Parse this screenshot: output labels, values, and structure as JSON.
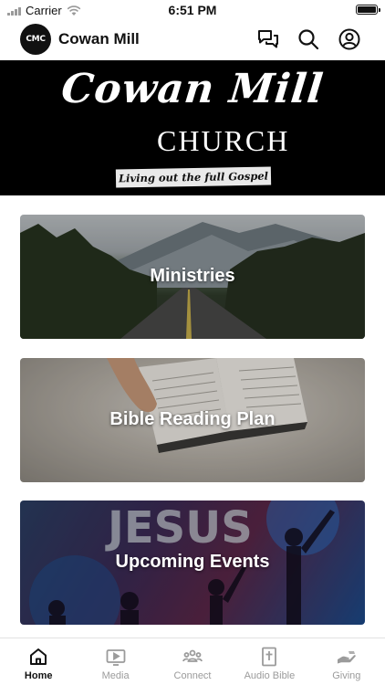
{
  "status_bar": {
    "carrier": "Carrier",
    "time": "6:51 PM"
  },
  "header": {
    "logo_text": "CMC",
    "title": "Cowan Mill"
  },
  "banner": {
    "script_title": "Cowan Mill",
    "subtitle": "CHURCH",
    "tagline": "Living out the full Gospel"
  },
  "cards": [
    {
      "label": "Ministries"
    },
    {
      "label": "Bible Reading Plan"
    },
    {
      "label": "Upcoming Events"
    }
  ],
  "cards_image_text": "JESUS",
  "tabs": [
    {
      "label": "Home",
      "icon": "home-icon",
      "active": true
    },
    {
      "label": "Media",
      "icon": "media-icon",
      "active": false
    },
    {
      "label": "Connect",
      "icon": "connect-icon",
      "active": false
    },
    {
      "label": "Audio Bible",
      "icon": "audio-bible-icon",
      "active": false
    },
    {
      "label": "Giving",
      "icon": "giving-icon",
      "active": false
    }
  ],
  "colors": {
    "active_tab": "#111111",
    "inactive_tab": "#9b9b9b",
    "banner_bg": "#000000"
  }
}
